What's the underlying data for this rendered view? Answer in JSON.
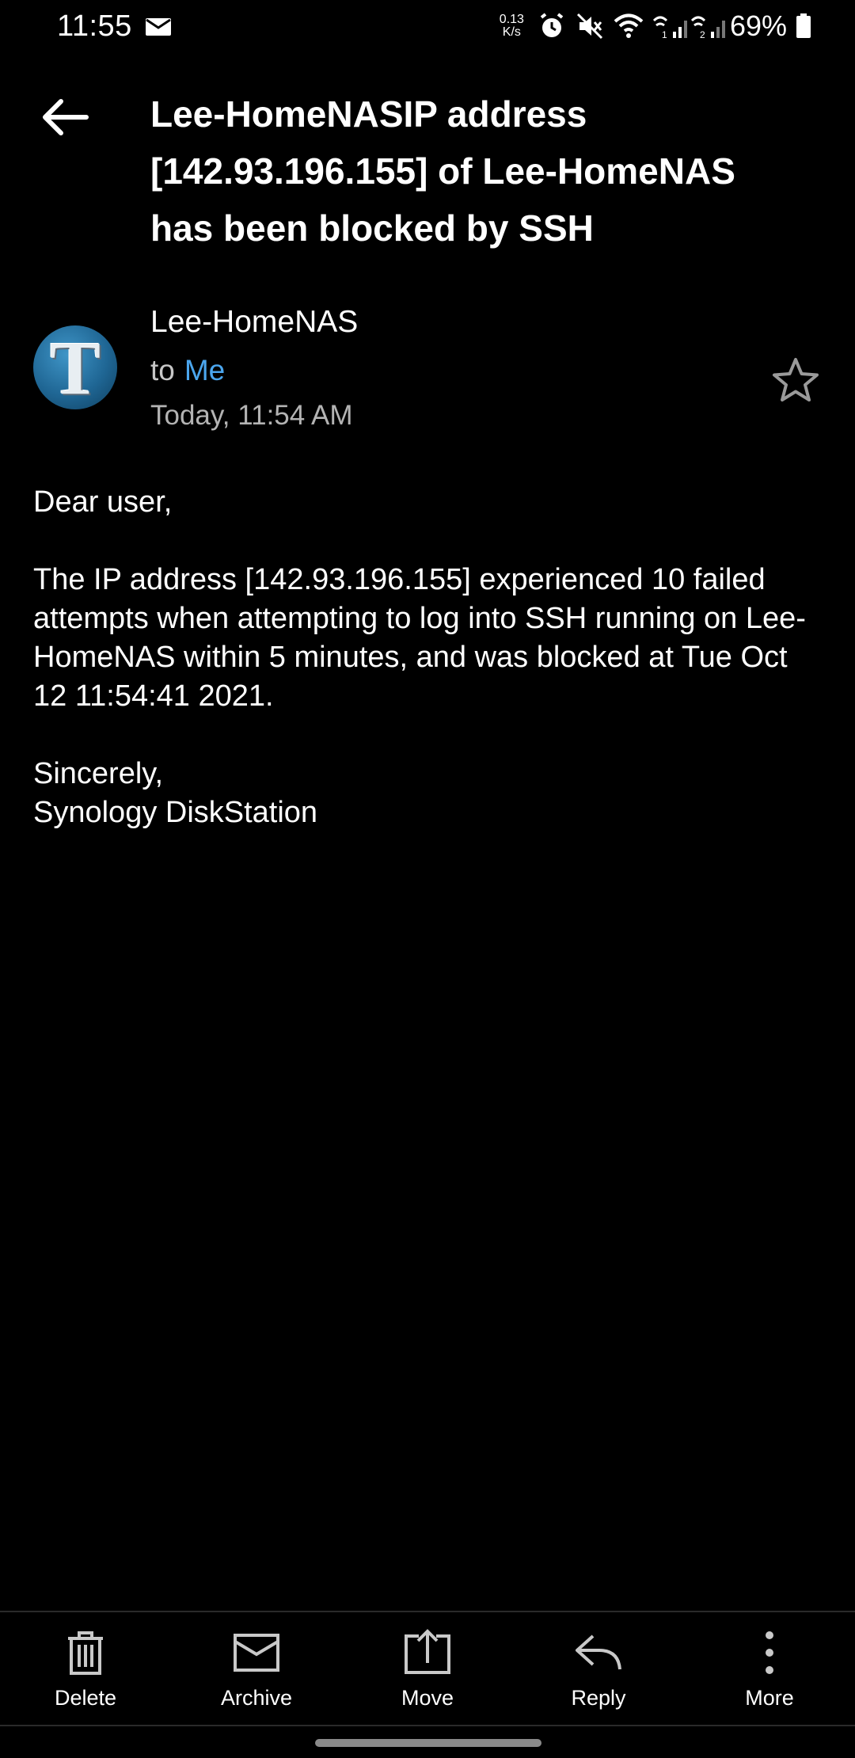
{
  "status_bar": {
    "time": "11:55",
    "net_speed_value": "0.13",
    "net_speed_unit": "K/s",
    "battery": "69%",
    "icons": [
      "mail-icon",
      "alarm-icon",
      "mute-icon",
      "wifi-icon",
      "signal-sim1-icon",
      "signal-sim2-icon",
      "battery-icon"
    ]
  },
  "email": {
    "subject": "Lee-HomeNASIP address [142.93.196.155] of Lee-HomeNAS has been blocked by SSH",
    "sender_name": "Lee-HomeNAS",
    "avatar_letter": "T",
    "to_label": "to",
    "to_recipient": "Me",
    "date": "Today, 11:54 AM",
    "body": {
      "greeting": "Dear user,",
      "message": "The IP address [142.93.196.155] experienced 10 failed attempts when attempting to log into SSH running on Lee-HomeNAS within 5 minutes, and was blocked at Tue Oct 12 11:54:41 2021.",
      "closing": "Sincerely,",
      "signature": "Synology DiskStation"
    }
  },
  "actions": {
    "delete": "Delete",
    "archive": "Archive",
    "move": "Move",
    "reply": "Reply",
    "more": "More"
  },
  "colors": {
    "background": "#000000",
    "link": "#4ba6ee",
    "secondary_text": "#b3b3b3"
  }
}
